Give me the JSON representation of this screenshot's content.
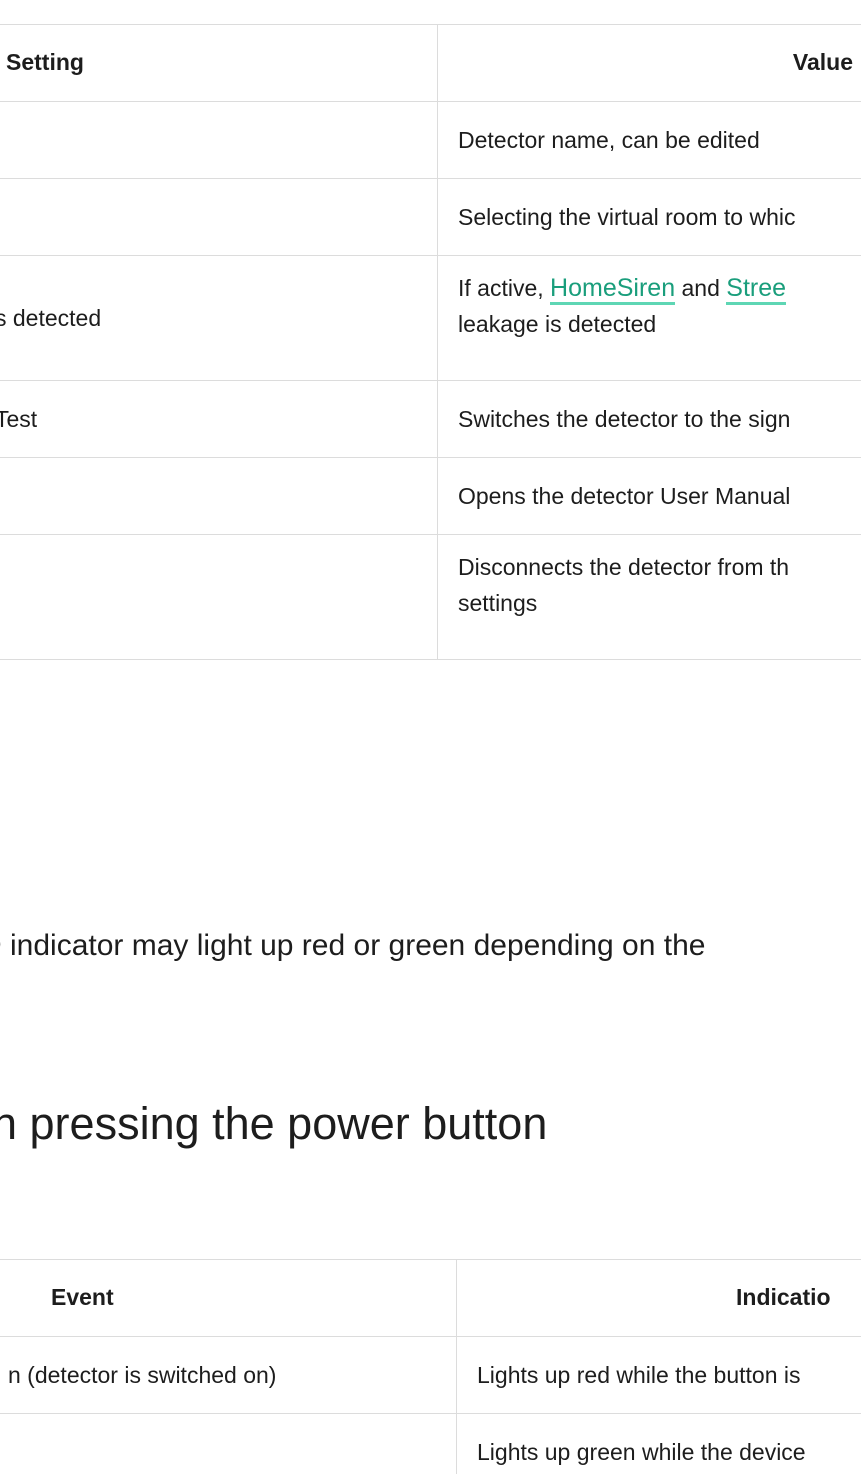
{
  "settings_table": {
    "header": {
      "setting": "Setting",
      "value": "Value"
    },
    "rows": [
      {
        "setting": "",
        "value": "Detector name, can be edited"
      },
      {
        "setting": "",
        "value": "Selecting the virtual room to whic"
      },
      {
        "setting": "s detected",
        "value_prefix": "If active, ",
        "link1": "HomeSiren",
        "value_mid": " and ",
        "link2": "Stree",
        "value_line2": "leakage is detected"
      },
      {
        "setting": "Test",
        "value": "Switches the detector to the sign"
      },
      {
        "setting": "",
        "value": "Opens the detector User Manual"
      },
      {
        "setting": "",
        "value": "Disconnects the detector from th",
        "value_line2": "settings"
      }
    ]
  },
  "paragraph": "D indicator may light up red or green depending on the",
  "section_heading": "n pressing the power button",
  "indication_table": {
    "header": {
      "event": "Event",
      "indication": "Indicatio"
    },
    "rows": [
      {
        "event": "n (detector is switched on)",
        "indication": "Lights up red while the button is"
      },
      {
        "event": "",
        "indication": "Lights up green while the device"
      }
    ]
  }
}
